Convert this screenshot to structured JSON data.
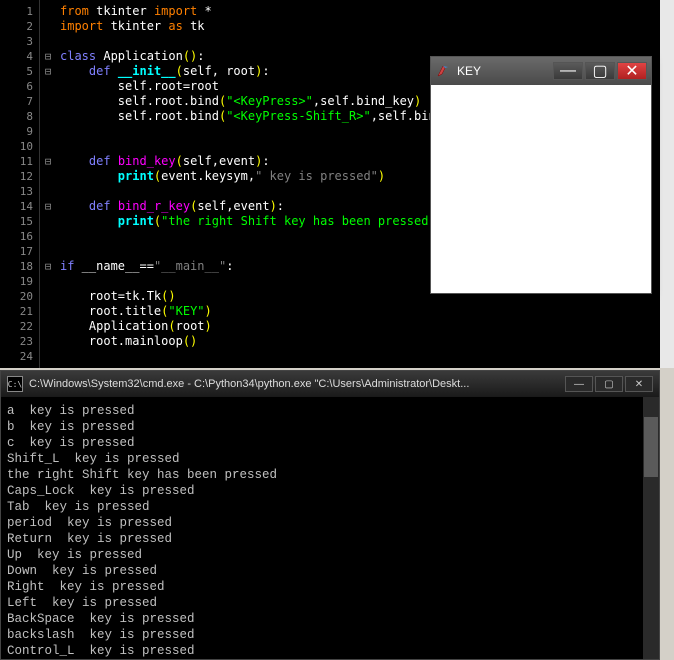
{
  "editor": {
    "line_numbers": [
      "1",
      "2",
      "3",
      "4",
      "5",
      "6",
      "7",
      "8",
      "9",
      "10",
      "11",
      "12",
      "13",
      "14",
      "15",
      "16",
      "17",
      "18",
      "19",
      "20",
      "21",
      "22",
      "23",
      "24"
    ],
    "fold_marks": {
      "4": "⊟",
      "5": "⊟",
      "11": "⊟",
      "14": "⊟",
      "18": "⊟"
    },
    "tokens": [
      [
        [
          "from",
          "kw-orange"
        ],
        [
          " tkinter ",
          ""
        ],
        [
          "import",
          "kw-orange"
        ],
        [
          " *",
          ""
        ]
      ],
      [
        [
          "import",
          "kw-orange"
        ],
        [
          " tkinter ",
          ""
        ],
        [
          "as",
          "kw-orange"
        ],
        [
          " tk",
          ""
        ]
      ],
      [],
      [
        [
          "class",
          "kw-blue"
        ],
        [
          " Application",
          ""
        ],
        [
          "()",
          "paren-y"
        ],
        [
          ":",
          ""
        ]
      ],
      [
        [
          "    ",
          ""
        ],
        [
          "def",
          "kw-blue"
        ],
        [
          " ",
          ""
        ],
        [
          "__init__",
          "kw-cyan"
        ],
        [
          "(",
          "paren-y"
        ],
        [
          "self, root",
          ""
        ],
        [
          ")",
          "paren-y"
        ],
        [
          ":",
          ""
        ]
      ],
      [
        [
          "        ",
          ""
        ],
        [
          "self.root=root",
          ""
        ]
      ],
      [
        [
          "        ",
          ""
        ],
        [
          "self.root.bind",
          ""
        ],
        [
          "(",
          "paren-y"
        ],
        [
          "\"<KeyPress>\"",
          "str-green"
        ],
        [
          ",self.bind_key",
          ""
        ],
        [
          ")",
          "paren-y"
        ]
      ],
      [
        [
          "        ",
          ""
        ],
        [
          "self.root.bind",
          ""
        ],
        [
          "(",
          "paren-y"
        ],
        [
          "\"<KeyPress-Shift_R>\"",
          "str-green"
        ],
        [
          ",self.bind_r_key",
          ""
        ],
        [
          ")",
          "paren-y"
        ]
      ],
      [],
      [],
      [
        [
          "    ",
          ""
        ],
        [
          "def",
          "kw-blue"
        ],
        [
          " ",
          ""
        ],
        [
          "bind_key",
          "kw-magenta"
        ],
        [
          "(",
          "paren-y"
        ],
        [
          "self,event",
          ""
        ],
        [
          ")",
          "paren-y"
        ],
        [
          ":",
          ""
        ]
      ],
      [
        [
          "        ",
          ""
        ],
        [
          "print",
          "kw-cyan"
        ],
        [
          "(",
          "paren-y"
        ],
        [
          "event.keysym,",
          ""
        ],
        [
          "\" key is pressed\"",
          "str"
        ],
        [
          ")",
          "paren-y"
        ]
      ],
      [],
      [
        [
          "    ",
          ""
        ],
        [
          "def",
          "kw-blue"
        ],
        [
          " ",
          ""
        ],
        [
          "bind_r_key",
          "kw-magenta"
        ],
        [
          "(",
          "paren-y"
        ],
        [
          "self,event",
          ""
        ],
        [
          ")",
          "paren-y"
        ],
        [
          ":",
          ""
        ]
      ],
      [
        [
          "        ",
          ""
        ],
        [
          "print",
          "kw-cyan"
        ],
        [
          "(",
          "paren-y"
        ],
        [
          "\"the right Shift key has been pressed\"",
          "str-green"
        ],
        [
          ")",
          "paren-y"
        ]
      ],
      [],
      [],
      [
        [
          "if",
          "kw-blue"
        ],
        [
          " __name__==",
          ""
        ],
        [
          "\"__main__\"",
          "str"
        ],
        [
          ":",
          ""
        ]
      ],
      [],
      [
        [
          "    ",
          ""
        ],
        [
          "root=tk.Tk",
          ""
        ],
        [
          "()",
          "paren-y"
        ]
      ],
      [
        [
          "    ",
          ""
        ],
        [
          "root.title",
          ""
        ],
        [
          "(",
          "paren-y"
        ],
        [
          "\"KEY\"",
          "str-green"
        ],
        [
          ")",
          "paren-y"
        ]
      ],
      [
        [
          "    ",
          ""
        ],
        [
          "Application",
          ""
        ],
        [
          "(",
          "paren-y"
        ],
        [
          "root",
          ""
        ],
        [
          ")",
          "paren-y"
        ]
      ],
      [
        [
          "    ",
          ""
        ],
        [
          "root.mainloop",
          ""
        ],
        [
          "()",
          "paren-y"
        ]
      ],
      []
    ]
  },
  "tk": {
    "title": "KEY",
    "icon_glyph": "🪶",
    "min": "—",
    "max": "▢",
    "close": "✕"
  },
  "cmd": {
    "icon_glyph": "C:\\",
    "title": "C:\\Windows\\System32\\cmd.exe - C:\\Python34\\python.exe  \"C:\\Users\\Administrator\\Deskt...",
    "min": "—",
    "max": "▢",
    "close": "✕",
    "lines": [
      "a  key is pressed",
      "b  key is pressed",
      "c  key is pressed",
      "Shift_L  key is pressed",
      "the right Shift key has been pressed",
      "Caps_Lock  key is pressed",
      "Tab  key is pressed",
      "period  key is pressed",
      "Return  key is pressed",
      "Up  key is pressed",
      "Down  key is pressed",
      "Right  key is pressed",
      "Left  key is pressed",
      "BackSpace  key is pressed",
      "backslash  key is pressed",
      "Control_L  key is pressed"
    ]
  }
}
